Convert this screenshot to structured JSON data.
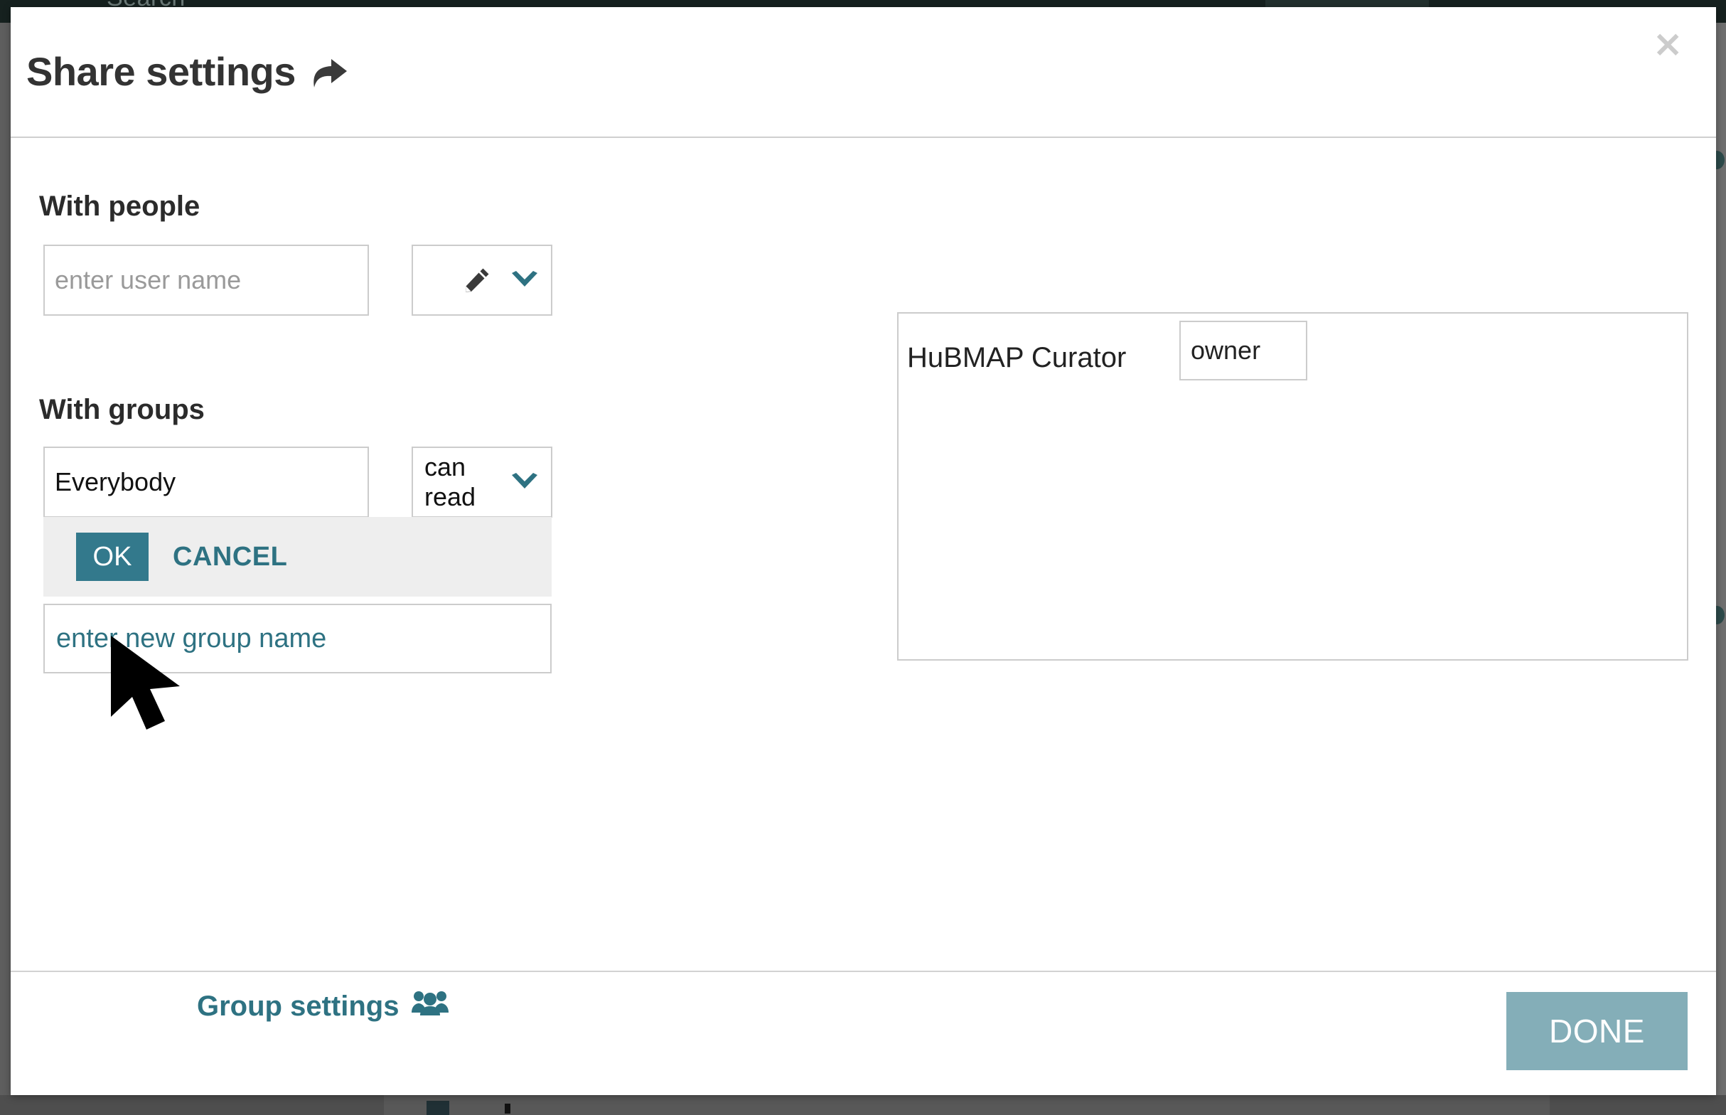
{
  "background": {
    "navbar_search_text": "Search"
  },
  "modal": {
    "title": "Share settings",
    "title_icon": "share-arrow-icon",
    "close_label": "×",
    "people": {
      "label": "With people",
      "input_placeholder": "enter user name",
      "input_value": "",
      "permission_icon": "pencil-icon",
      "permission_value": "",
      "dropdown_icon": "chevron-down-icon"
    },
    "groups": {
      "label": "With groups",
      "group_name": "Everybody",
      "permission_value": "can read",
      "dropdown_icon": "chevron-down-icon",
      "confirm": {
        "ok_label": "OK",
        "cancel_label": "CANCEL"
      },
      "new_group_placeholder": "enter new group name",
      "group_settings_label": "Group settings",
      "group_settings_icon": "users-group-icon"
    },
    "members_panel": {
      "rows": [
        {
          "name": "HuBMAP Curator",
          "role": "owner"
        }
      ]
    },
    "footer": {
      "done_label": "DONE"
    }
  },
  "colors": {
    "accent_teal": "#2e7282",
    "ok_button": "#33798c",
    "done_button": "#84aeb8",
    "border_gray": "#cccccc",
    "bar_gray": "#eeeeee"
  }
}
